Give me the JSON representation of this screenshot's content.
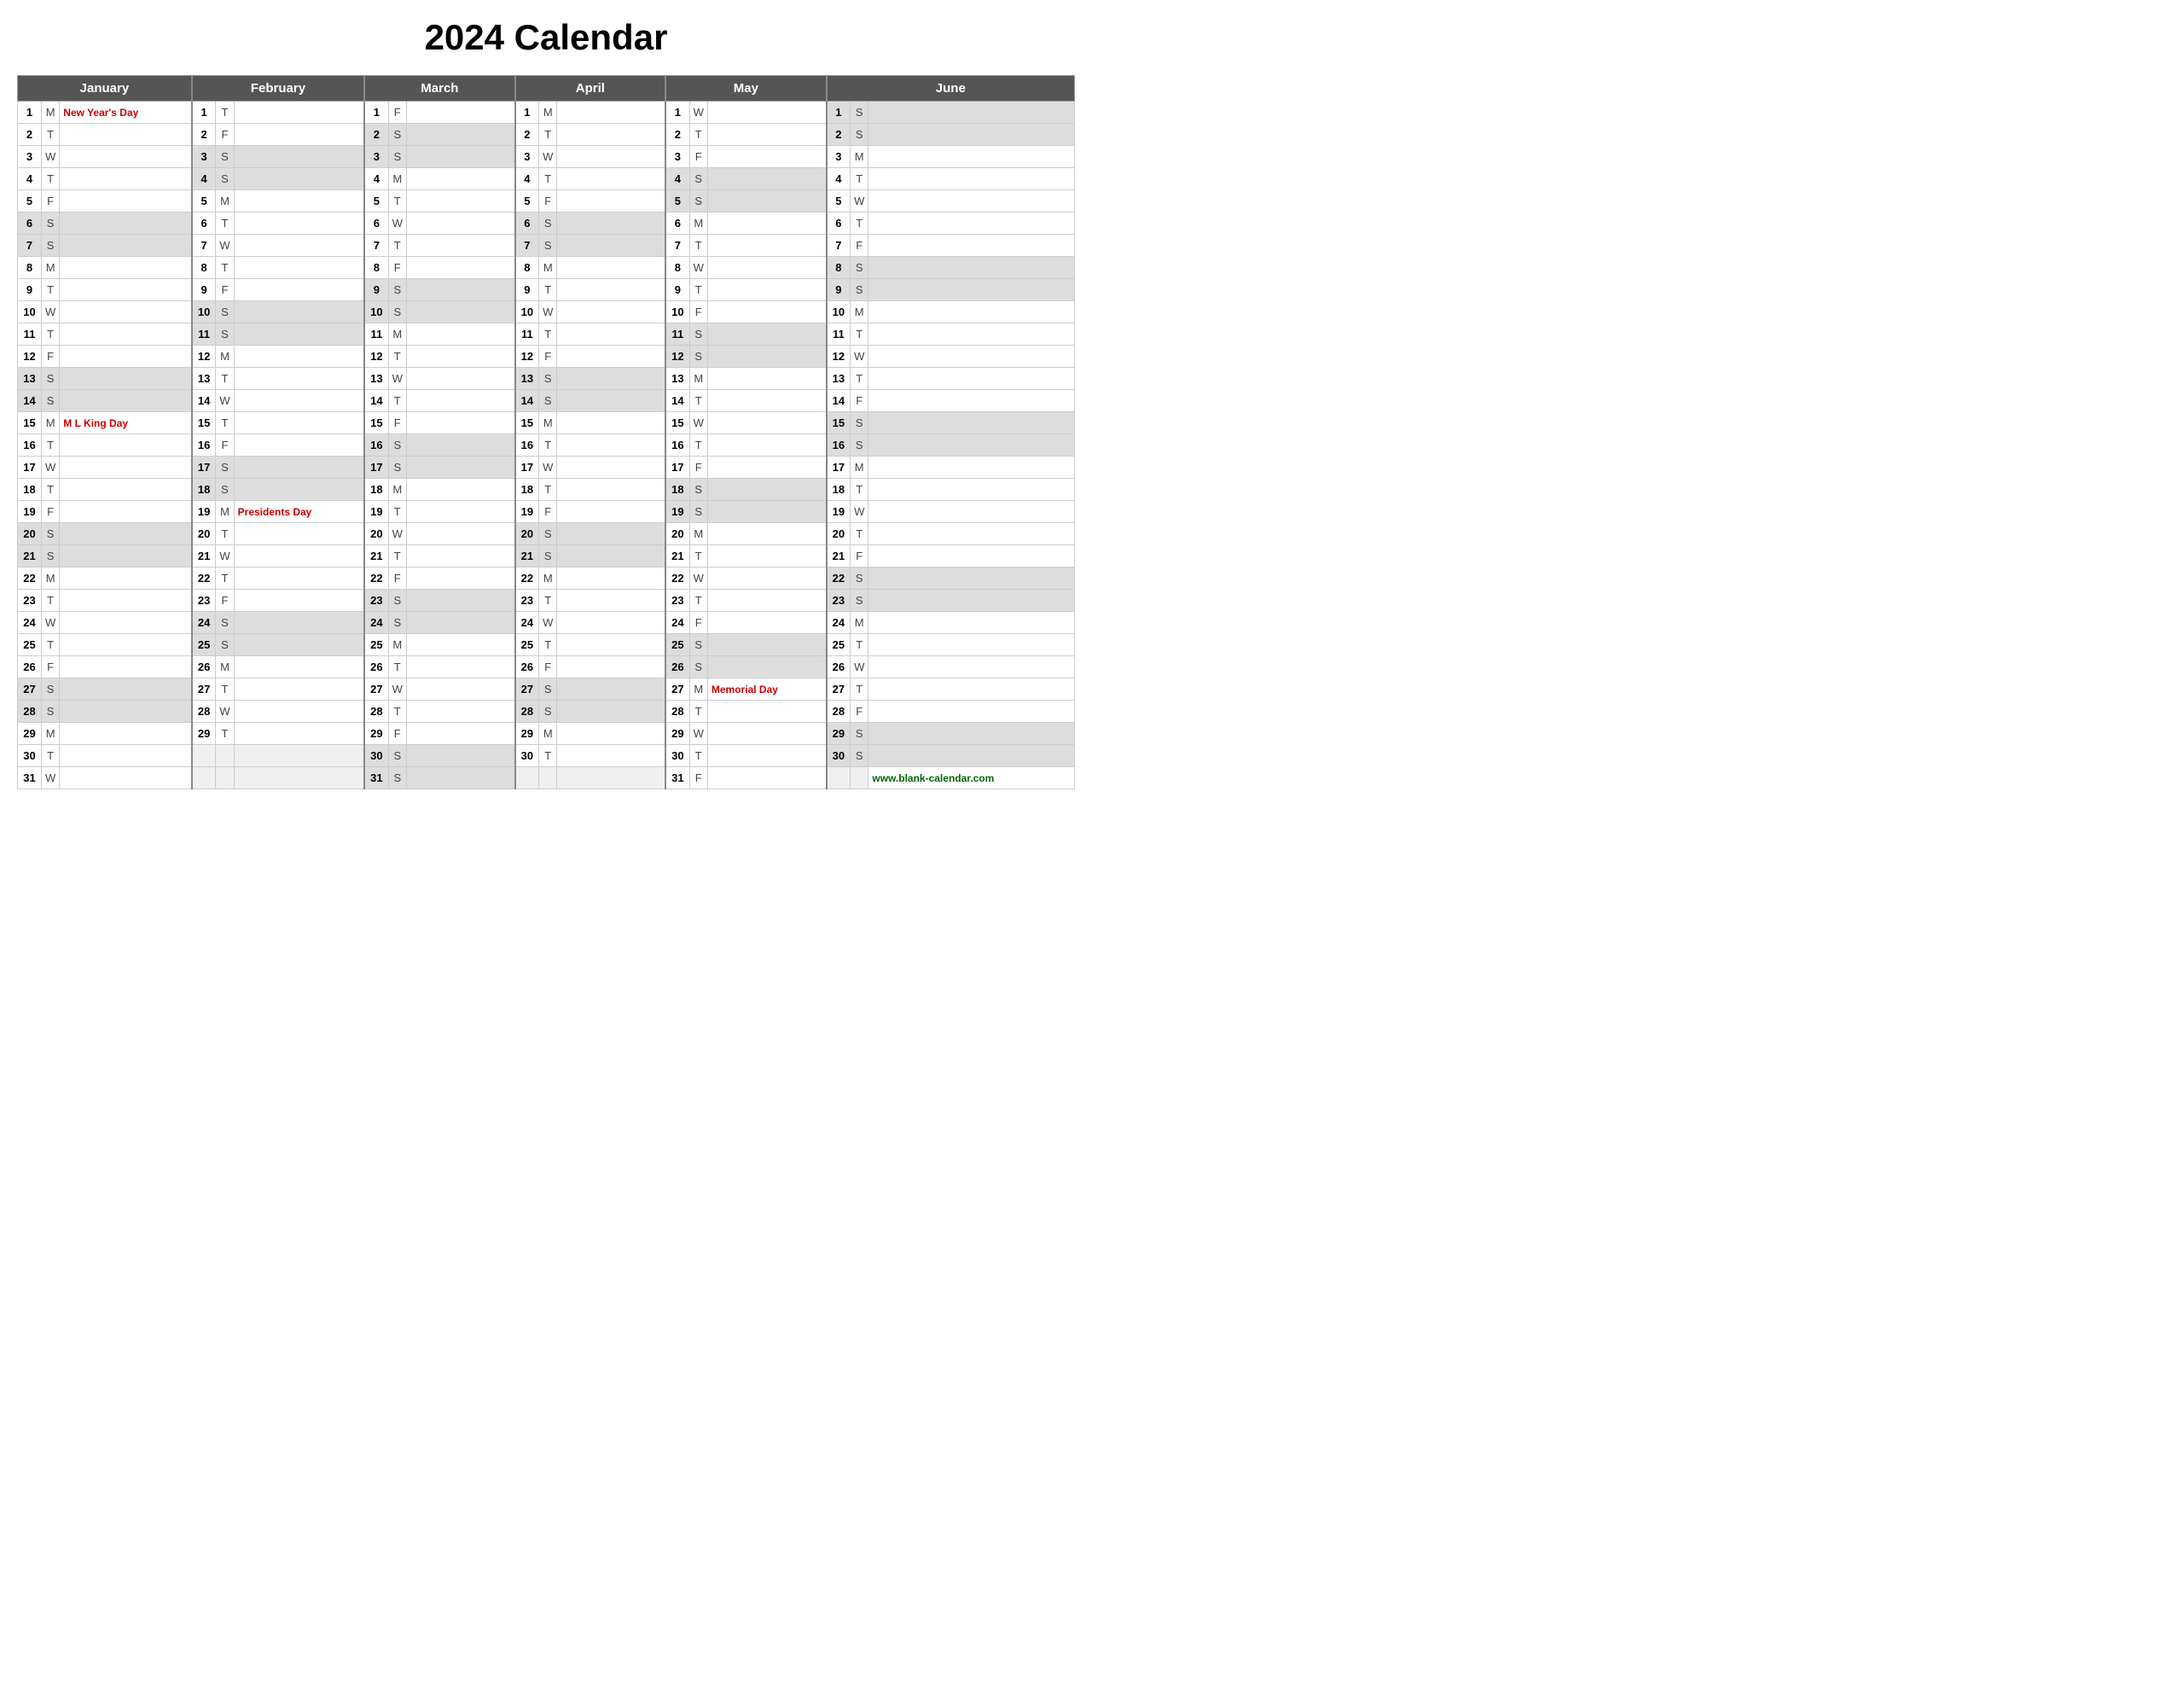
{
  "title": "2024 Calendar",
  "months": [
    "January",
    "February",
    "March",
    "April",
    "May",
    "June"
  ],
  "website": "www.blank-calendar.com",
  "rows": [
    {
      "day": 1,
      "jan": {
        "d": "M",
        "h": "New Year's Day",
        "hc": "red"
      },
      "feb": {
        "d": "T",
        "h": ""
      },
      "mar": {
        "d": "F",
        "h": ""
      },
      "apr": {
        "d": "M",
        "h": ""
      },
      "may": {
        "d": "W",
        "h": ""
      },
      "jun": {
        "d": "S",
        "h": "",
        "w": true
      }
    },
    {
      "day": 2,
      "jan": {
        "d": "T",
        "h": ""
      },
      "feb": {
        "d": "F",
        "h": ""
      },
      "mar": {
        "d": "S",
        "h": "",
        "w": true
      },
      "apr": {
        "d": "T",
        "h": ""
      },
      "may": {
        "d": "T",
        "h": ""
      },
      "jun": {
        "d": "S",
        "h": "",
        "w": true
      }
    },
    {
      "day": 3,
      "jan": {
        "d": "W",
        "h": ""
      },
      "feb": {
        "d": "S",
        "h": "",
        "w": true
      },
      "mar": {
        "d": "S",
        "h": "",
        "w": true
      },
      "apr": {
        "d": "W",
        "h": ""
      },
      "may": {
        "d": "F",
        "h": ""
      },
      "jun": {
        "d": "M",
        "h": ""
      }
    },
    {
      "day": 4,
      "jan": {
        "d": "T",
        "h": ""
      },
      "feb": {
        "d": "S",
        "h": "",
        "w": true
      },
      "mar": {
        "d": "M",
        "h": ""
      },
      "apr": {
        "d": "T",
        "h": ""
      },
      "may": {
        "d": "S",
        "h": "",
        "w": true
      },
      "jun": {
        "d": "T",
        "h": ""
      }
    },
    {
      "day": 5,
      "jan": {
        "d": "F",
        "h": ""
      },
      "feb": {
        "d": "M",
        "h": ""
      },
      "mar": {
        "d": "T",
        "h": ""
      },
      "apr": {
        "d": "F",
        "h": ""
      },
      "may": {
        "d": "S",
        "h": "",
        "w": true
      },
      "jun": {
        "d": "W",
        "h": ""
      }
    },
    {
      "day": 6,
      "jan": {
        "d": "S",
        "h": "",
        "w": true
      },
      "feb": {
        "d": "T",
        "h": ""
      },
      "mar": {
        "d": "W",
        "h": ""
      },
      "apr": {
        "d": "S",
        "h": "",
        "w": true
      },
      "may": {
        "d": "M",
        "h": ""
      },
      "jun": {
        "d": "T",
        "h": ""
      }
    },
    {
      "day": 7,
      "jan": {
        "d": "S",
        "h": "",
        "w": true
      },
      "feb": {
        "d": "W",
        "h": ""
      },
      "mar": {
        "d": "T",
        "h": ""
      },
      "apr": {
        "d": "S",
        "h": "",
        "w": true
      },
      "may": {
        "d": "T",
        "h": ""
      },
      "jun": {
        "d": "F",
        "h": ""
      }
    },
    {
      "day": 8,
      "jan": {
        "d": "M",
        "h": ""
      },
      "feb": {
        "d": "T",
        "h": ""
      },
      "mar": {
        "d": "F",
        "h": ""
      },
      "apr": {
        "d": "M",
        "h": ""
      },
      "may": {
        "d": "W",
        "h": ""
      },
      "jun": {
        "d": "S",
        "h": "",
        "w": true
      }
    },
    {
      "day": 9,
      "jan": {
        "d": "T",
        "h": ""
      },
      "feb": {
        "d": "F",
        "h": ""
      },
      "mar": {
        "d": "S",
        "h": "",
        "w": true
      },
      "apr": {
        "d": "T",
        "h": ""
      },
      "may": {
        "d": "T",
        "h": ""
      },
      "jun": {
        "d": "S",
        "h": "",
        "w": true
      }
    },
    {
      "day": 10,
      "jan": {
        "d": "W",
        "h": ""
      },
      "feb": {
        "d": "S",
        "h": "",
        "w": true
      },
      "mar": {
        "d": "S",
        "h": "",
        "w": true
      },
      "apr": {
        "d": "W",
        "h": ""
      },
      "may": {
        "d": "F",
        "h": ""
      },
      "jun": {
        "d": "M",
        "h": ""
      }
    },
    {
      "day": 11,
      "jan": {
        "d": "T",
        "h": ""
      },
      "feb": {
        "d": "S",
        "h": "",
        "w": true
      },
      "mar": {
        "d": "M",
        "h": ""
      },
      "apr": {
        "d": "T",
        "h": ""
      },
      "may": {
        "d": "S",
        "h": "",
        "w": true
      },
      "jun": {
        "d": "T",
        "h": ""
      }
    },
    {
      "day": 12,
      "jan": {
        "d": "F",
        "h": ""
      },
      "feb": {
        "d": "M",
        "h": ""
      },
      "mar": {
        "d": "T",
        "h": ""
      },
      "apr": {
        "d": "F",
        "h": ""
      },
      "may": {
        "d": "S",
        "h": "",
        "w": true
      },
      "jun": {
        "d": "W",
        "h": ""
      }
    },
    {
      "day": 13,
      "jan": {
        "d": "S",
        "h": "",
        "w": true
      },
      "feb": {
        "d": "T",
        "h": ""
      },
      "mar": {
        "d": "W",
        "h": ""
      },
      "apr": {
        "d": "S",
        "h": "",
        "w": true
      },
      "may": {
        "d": "M",
        "h": ""
      },
      "jun": {
        "d": "T",
        "h": ""
      }
    },
    {
      "day": 14,
      "jan": {
        "d": "S",
        "h": "",
        "w": true
      },
      "feb": {
        "d": "W",
        "h": ""
      },
      "mar": {
        "d": "T",
        "h": ""
      },
      "apr": {
        "d": "S",
        "h": "",
        "w": true
      },
      "may": {
        "d": "T",
        "h": ""
      },
      "jun": {
        "d": "F",
        "h": ""
      }
    },
    {
      "day": 15,
      "jan": {
        "d": "M",
        "h": "M L King Day",
        "hc": "red"
      },
      "feb": {
        "d": "T",
        "h": ""
      },
      "mar": {
        "d": "F",
        "h": ""
      },
      "apr": {
        "d": "M",
        "h": ""
      },
      "may": {
        "d": "W",
        "h": ""
      },
      "jun": {
        "d": "S",
        "h": "",
        "w": true
      }
    },
    {
      "day": 16,
      "jan": {
        "d": "T",
        "h": ""
      },
      "feb": {
        "d": "F",
        "h": ""
      },
      "mar": {
        "d": "S",
        "h": "",
        "w": true
      },
      "apr": {
        "d": "T",
        "h": ""
      },
      "may": {
        "d": "T",
        "h": ""
      },
      "jun": {
        "d": "S",
        "h": "",
        "w": true
      }
    },
    {
      "day": 17,
      "jan": {
        "d": "W",
        "h": ""
      },
      "feb": {
        "d": "S",
        "h": "",
        "w": true
      },
      "mar": {
        "d": "S",
        "h": "",
        "w": true
      },
      "apr": {
        "d": "W",
        "h": ""
      },
      "may": {
        "d": "F",
        "h": ""
      },
      "jun": {
        "d": "M",
        "h": ""
      }
    },
    {
      "day": 18,
      "jan": {
        "d": "T",
        "h": ""
      },
      "feb": {
        "d": "S",
        "h": "",
        "w": true
      },
      "mar": {
        "d": "M",
        "h": ""
      },
      "apr": {
        "d": "T",
        "h": ""
      },
      "may": {
        "d": "S",
        "h": "",
        "w": true
      },
      "jun": {
        "d": "T",
        "h": ""
      }
    },
    {
      "day": 19,
      "jan": {
        "d": "F",
        "h": ""
      },
      "feb": {
        "d": "M",
        "h": "Presidents Day",
        "hc": "red"
      },
      "mar": {
        "d": "T",
        "h": ""
      },
      "apr": {
        "d": "F",
        "h": ""
      },
      "may": {
        "d": "S",
        "h": "",
        "w": true
      },
      "jun": {
        "d": "W",
        "h": ""
      }
    },
    {
      "day": 20,
      "jan": {
        "d": "S",
        "h": "",
        "w": true
      },
      "feb": {
        "d": "T",
        "h": ""
      },
      "mar": {
        "d": "W",
        "h": ""
      },
      "apr": {
        "d": "S",
        "h": "",
        "w": true
      },
      "may": {
        "d": "M",
        "h": ""
      },
      "jun": {
        "d": "T",
        "h": ""
      }
    },
    {
      "day": 21,
      "jan": {
        "d": "S",
        "h": "",
        "w": true
      },
      "feb": {
        "d": "W",
        "h": ""
      },
      "mar": {
        "d": "T",
        "h": ""
      },
      "apr": {
        "d": "S",
        "h": "",
        "w": true
      },
      "may": {
        "d": "T",
        "h": ""
      },
      "jun": {
        "d": "F",
        "h": ""
      }
    },
    {
      "day": 22,
      "jan": {
        "d": "M",
        "h": ""
      },
      "feb": {
        "d": "T",
        "h": ""
      },
      "mar": {
        "d": "F",
        "h": ""
      },
      "apr": {
        "d": "M",
        "h": ""
      },
      "may": {
        "d": "W",
        "h": ""
      },
      "jun": {
        "d": "S",
        "h": "",
        "w": true
      }
    },
    {
      "day": 23,
      "jan": {
        "d": "T",
        "h": ""
      },
      "feb": {
        "d": "F",
        "h": ""
      },
      "mar": {
        "d": "S",
        "h": "",
        "w": true
      },
      "apr": {
        "d": "T",
        "h": ""
      },
      "may": {
        "d": "T",
        "h": ""
      },
      "jun": {
        "d": "S",
        "h": "",
        "w": true
      }
    },
    {
      "day": 24,
      "jan": {
        "d": "W",
        "h": ""
      },
      "feb": {
        "d": "S",
        "h": "",
        "w": true
      },
      "mar": {
        "d": "S",
        "h": "",
        "w": true
      },
      "apr": {
        "d": "W",
        "h": ""
      },
      "may": {
        "d": "F",
        "h": ""
      },
      "jun": {
        "d": "M",
        "h": ""
      }
    },
    {
      "day": 25,
      "jan": {
        "d": "T",
        "h": ""
      },
      "feb": {
        "d": "S",
        "h": "",
        "w": true
      },
      "mar": {
        "d": "M",
        "h": ""
      },
      "apr": {
        "d": "T",
        "h": ""
      },
      "may": {
        "d": "S",
        "h": "",
        "w": true
      },
      "jun": {
        "d": "T",
        "h": ""
      }
    },
    {
      "day": 26,
      "jan": {
        "d": "F",
        "h": ""
      },
      "feb": {
        "d": "M",
        "h": ""
      },
      "mar": {
        "d": "T",
        "h": ""
      },
      "apr": {
        "d": "F",
        "h": ""
      },
      "may": {
        "d": "S",
        "h": "",
        "w": true
      },
      "jun": {
        "d": "W",
        "h": ""
      }
    },
    {
      "day": 27,
      "jan": {
        "d": "S",
        "h": "",
        "w": true
      },
      "feb": {
        "d": "T",
        "h": ""
      },
      "mar": {
        "d": "W",
        "h": ""
      },
      "apr": {
        "d": "S",
        "h": "",
        "w": true
      },
      "may": {
        "d": "M",
        "h": "Memorial Day",
        "hc": "red"
      },
      "jun": {
        "d": "T",
        "h": ""
      }
    },
    {
      "day": 28,
      "jan": {
        "d": "S",
        "h": "",
        "w": true
      },
      "feb": {
        "d": "W",
        "h": ""
      },
      "mar": {
        "d": "T",
        "h": ""
      },
      "apr": {
        "d": "S",
        "h": "",
        "w": true
      },
      "may": {
        "d": "T",
        "h": ""
      },
      "jun": {
        "d": "F",
        "h": ""
      }
    },
    {
      "day": 29,
      "jan": {
        "d": "M",
        "h": ""
      },
      "feb": {
        "d": "T",
        "h": ""
      },
      "mar": {
        "d": "F",
        "h": ""
      },
      "apr": {
        "d": "M",
        "h": ""
      },
      "may": {
        "d": "W",
        "h": ""
      },
      "jun": {
        "d": "S",
        "h": "",
        "w": true
      }
    },
    {
      "day": 30,
      "jan": {
        "d": "T",
        "h": ""
      },
      "feb": null,
      "mar": {
        "d": "S",
        "h": "",
        "w": true
      },
      "apr": {
        "d": "T",
        "h": ""
      },
      "may": {
        "d": "T",
        "h": ""
      },
      "jun": {
        "d": "S",
        "h": "",
        "w": true
      }
    },
    {
      "day": 31,
      "jan": {
        "d": "W",
        "h": ""
      },
      "feb": null,
      "mar": {
        "d": "S",
        "h": "",
        "w": true
      },
      "apr": null,
      "may": {
        "d": "F",
        "h": ""
      },
      "jun": null
    }
  ]
}
